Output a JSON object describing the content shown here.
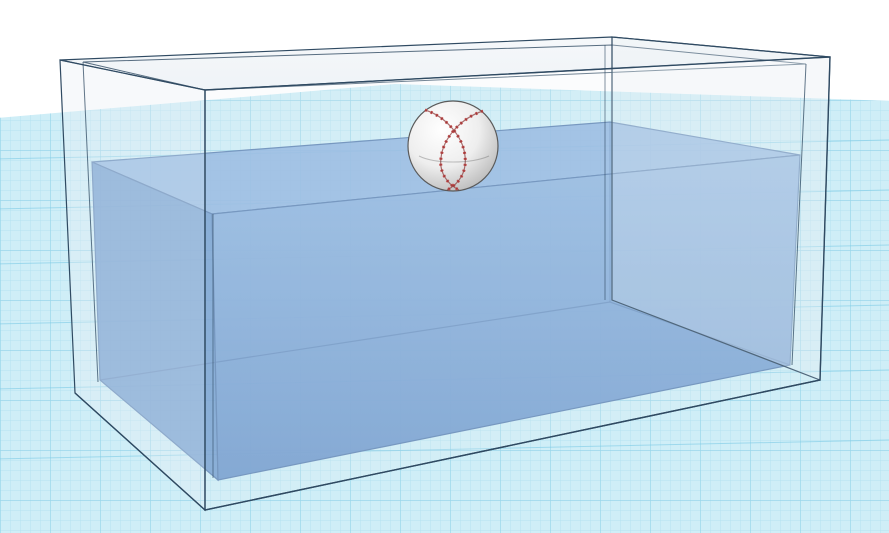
{
  "viewport": {
    "background_sky": "#ffffff",
    "workplane_color": "#bfe7f3",
    "workplane_grid_minor": "#9fd7ea",
    "workplane_grid_major": "#6fc2df"
  },
  "objects": {
    "tank": {
      "frame_color": "#2f4a62",
      "glass_fill": "#e9eef3"
    },
    "water": {
      "fill": "#7aa6d6",
      "edge": "#5f86b5"
    },
    "baseball": {
      "icon": "baseball-icon",
      "leather_color": "#f2f2f2",
      "stitch_color": "#c44a4a"
    }
  }
}
